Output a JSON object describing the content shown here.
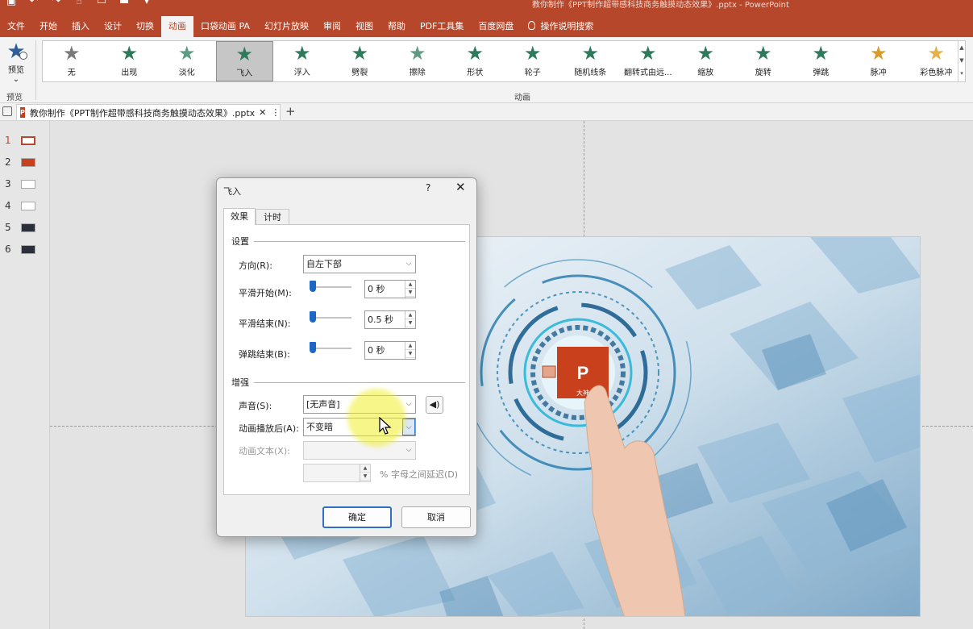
{
  "app": {
    "doc_title": "教你制作《PPT制作超带感科技商务触摸动态效果》.pptx - PowerPoint"
  },
  "menu": [
    "文件",
    "开始",
    "插入",
    "设计",
    "切换",
    "动画",
    "口袋动画 PA",
    "幻灯片放映",
    "审阅",
    "视图",
    "帮助",
    "PDF工具集",
    "百度网盘",
    "操作说明搜索"
  ],
  "menu_active": "动画",
  "ribbon": {
    "preview_label": "预览",
    "preview_group": "预览",
    "animation_group": "动画",
    "effects": [
      {
        "label": "无",
        "color": "#7a7a7a"
      },
      {
        "label": "出现",
        "color": "#2f7a5b"
      },
      {
        "label": "淡化",
        "color": "#5f9b84"
      },
      {
        "label": "飞入",
        "color": "#2f7a5b"
      },
      {
        "label": "浮入",
        "color": "#2f7a5b"
      },
      {
        "label": "劈裂",
        "color": "#2f7a5b"
      },
      {
        "label": "擦除",
        "color": "#5f9b84"
      },
      {
        "label": "形状",
        "color": "#2f7a5b"
      },
      {
        "label": "轮子",
        "color": "#2f7a5b"
      },
      {
        "label": "随机线条",
        "color": "#2f7a5b"
      },
      {
        "label": "翻转式由远...",
        "color": "#2f7a5b"
      },
      {
        "label": "缩放",
        "color": "#2f7a5b"
      },
      {
        "label": "旋转",
        "color": "#2f7a5b"
      },
      {
        "label": "弹跳",
        "color": "#2f7a5b"
      },
      {
        "label": "脉冲",
        "color": "#d89c2a"
      },
      {
        "label": "彩色脉冲",
        "color": "#e3b24a"
      }
    ],
    "selected_effect": "飞入"
  },
  "doc_tab": {
    "label": "教你制作《PPT制作超带感科技商务触摸动态效果》.pptx"
  },
  "slides": [
    "1",
    "2",
    "3",
    "4",
    "5",
    "6"
  ],
  "active_slide": "1",
  "slide_badge": "1",
  "dialog": {
    "title": "飞入",
    "help": "?",
    "tabs": [
      "效果",
      "计时"
    ],
    "settings_label": "设置",
    "direction_label": "方向(R):",
    "direction_value": "自左下部",
    "smooth_start_label": "平滑开始(M):",
    "smooth_start_value": "0 秒",
    "smooth_end_label": "平滑结束(N):",
    "smooth_end_value": "0.5 秒",
    "bounce_end_label": "弹跳结束(B):",
    "bounce_end_value": "0 秒",
    "enhance_label": "增强",
    "sound_label": "声音(S):",
    "sound_value": "[无声音]",
    "after_anim_label": "动画播放后(A):",
    "after_anim_value": "不变暗",
    "anim_text_label": "动画文本(X):",
    "delay_label": "% 字母之间延迟(D)",
    "ok": "确定",
    "cancel": "取消"
  },
  "colors": {
    "brand": "#b7472a",
    "accent": "#1c66c6"
  }
}
